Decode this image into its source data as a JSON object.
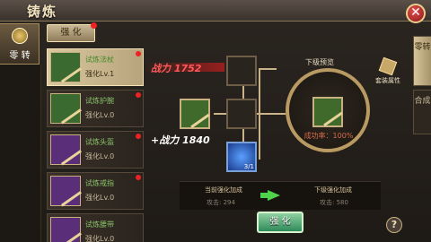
{
  "title": "铸炼",
  "left_tab": {
    "label": "零 转"
  },
  "subtab": {
    "label": "强 化"
  },
  "items": [
    {
      "name": "试炼法杖",
      "level": "强化Lv.1",
      "selected": true,
      "color": "green",
      "dot": true
    },
    {
      "name": "试炼护腕",
      "level": "强化Lv.0",
      "selected": false,
      "color": "green",
      "dot": true
    },
    {
      "name": "试炼头盔",
      "level": "强化Lv.0",
      "selected": false,
      "color": "purple",
      "dot": true
    },
    {
      "name": "试炼戒指",
      "level": "强化Lv.0",
      "selected": false,
      "color": "purple",
      "dot": true
    },
    {
      "name": "试炼腰带",
      "level": "强化Lv.0",
      "selected": false,
      "color": "purple",
      "dot": false
    }
  ],
  "power_top": "战力 1752",
  "power_bottom": "+战力 1840",
  "gem_count": "3/1",
  "preview_label": "下级预览",
  "success_rate": "成功率：100%",
  "suit_label": "套装属性",
  "right_tabs": [
    {
      "label": "零转",
      "active": true
    },
    {
      "label": "合成",
      "active": false
    }
  ],
  "info": {
    "current_title": "当前强化加成",
    "current_value": "攻击: 294",
    "next_title": "下级强化加成",
    "next_value": "攻击: 580"
  },
  "forge_button": "强 化",
  "help_icon": "?",
  "close_icon": "✕"
}
